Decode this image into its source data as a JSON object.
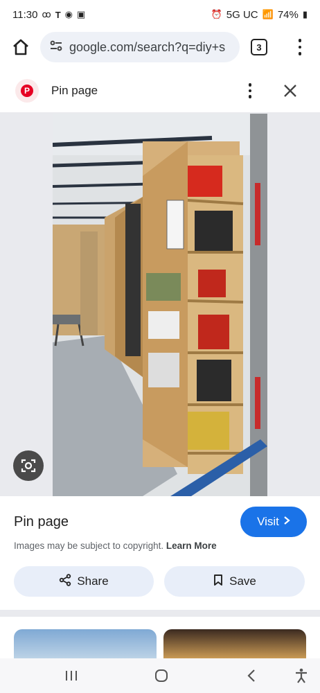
{
  "status_bar": {
    "time": "11:30",
    "network": "5G UC",
    "battery": "74%"
  },
  "browser": {
    "url": "google.com/search?q=diy+s",
    "tab_count": "3"
  },
  "pin_header": {
    "title": "Pin page"
  },
  "info": {
    "title": "Pin page",
    "visit_label": "Visit",
    "copyright_text": "Images may be subject to copyright.",
    "learn_more": "Learn More",
    "share_label": "Share",
    "save_label": "Save"
  },
  "icons": {
    "home": "home-icon",
    "site_info": "site-info-icon",
    "more": "more-vert-icon",
    "close": "close-icon",
    "lens": "lens-icon",
    "share": "share-icon",
    "bookmark": "bookmark-icon",
    "recents": "recents-icon",
    "home_nav": "home-nav-icon",
    "back": "back-icon",
    "accessibility": "accessibility-icon"
  },
  "colors": {
    "visit_button": "#1a73e8",
    "pill_button": "#e8eef9",
    "pinterest": "#e60023"
  }
}
